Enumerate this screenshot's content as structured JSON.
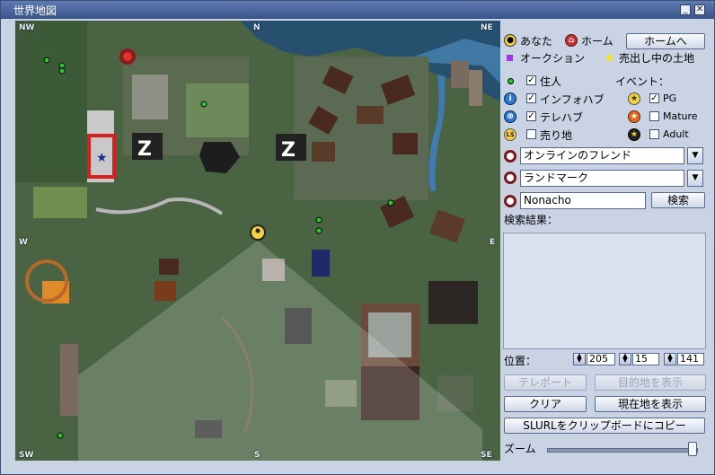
{
  "window": {
    "title": "世界地図",
    "minimize_glyph": "_",
    "close_glyph": "✕"
  },
  "map": {
    "corners": {
      "nw": "NW",
      "n": "N",
      "ne": "NE",
      "w": "W",
      "e": "E",
      "sw": "SW",
      "s": "S",
      "se": "SE"
    }
  },
  "legend": {
    "you": "あなた",
    "home": "ホーム",
    "home_button": "ホームへ",
    "auction": "オークション",
    "for_sale_land": "売出し中の土地"
  },
  "filters": {
    "resident": "住人",
    "infohub": "インフォハブ",
    "telehub": "テレハブ",
    "for_sale": "売り地",
    "events_label": "イベント：",
    "pg": "PG",
    "mature": "Mature",
    "adult": "Adult",
    "checked": {
      "resident": true,
      "infohub": true,
      "telehub": true,
      "for_sale": false,
      "pg": true,
      "mature": false,
      "adult": false
    }
  },
  "friends_combo": {
    "value": "オンラインのフレンド"
  },
  "landmark_combo": {
    "value": "ランドマーク"
  },
  "search": {
    "value": "Nonacho",
    "button": "検索"
  },
  "results": {
    "label": "検索結果："
  },
  "location": {
    "label": "位置：",
    "x": "205",
    "y": "15",
    "z": "141"
  },
  "buttons": {
    "teleport": "テレポート",
    "show_destination": "目的地を表示",
    "clear": "クリア",
    "show_current": "現在地を表示",
    "copy_slurl": "SLURLをクリップボードにコピー"
  },
  "zoom": {
    "label": "ズーム",
    "level": 0.97
  },
  "colors": {
    "accent": "#39548a",
    "auction": "#9a3cdc",
    "for_sale": "#f3e23a",
    "resident": "#22cc22"
  }
}
